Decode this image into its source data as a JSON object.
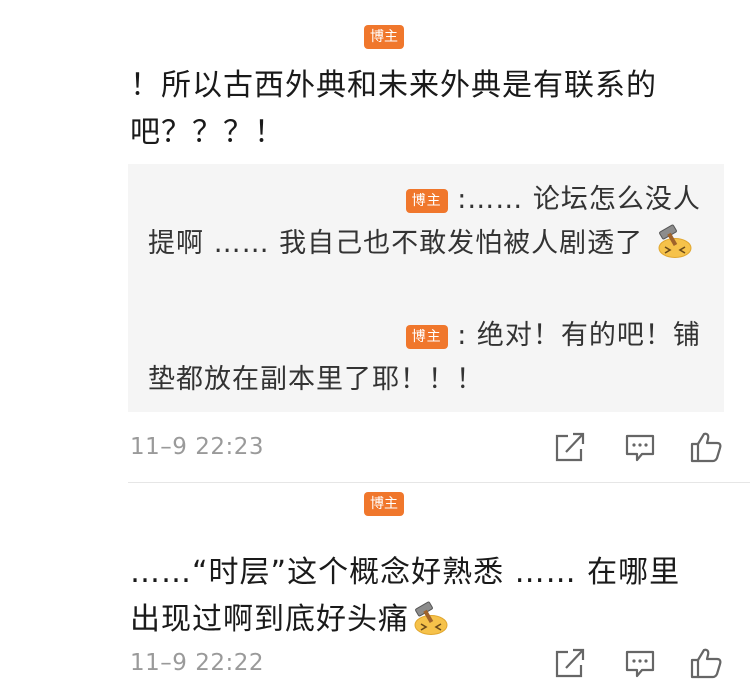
{
  "comments": [
    {
      "badge": "博主",
      "text": "！所以古西外典和未来外典是有联系的吧？？？！",
      "replies": [
        {
          "badge": "博主",
          "text": ":…… 论坛怎么没人提啊 …… 我自己也不敢发怕被人剧透了"
        },
        {
          "badge": "博主",
          "text": ": 绝对！有的吧！铺垫都放在副本里了耶！！！"
        }
      ],
      "time": "11–9 22:23"
    },
    {
      "badge": "博主",
      "text": "……“时层”这个概念好熟悉 …… 在哪里出现过啊到底好头痛",
      "time": "11–9 22:22"
    }
  ],
  "icons": {
    "share": "share-icon",
    "comment": "comment-icon",
    "like": "thumbs-up-icon",
    "emoji": "hammer-face-emoji"
  },
  "colors": {
    "badge": "#f0772c",
    "reply_bg": "#f5f5f5",
    "meta": "#9a9a9a",
    "icon": "#666666"
  }
}
